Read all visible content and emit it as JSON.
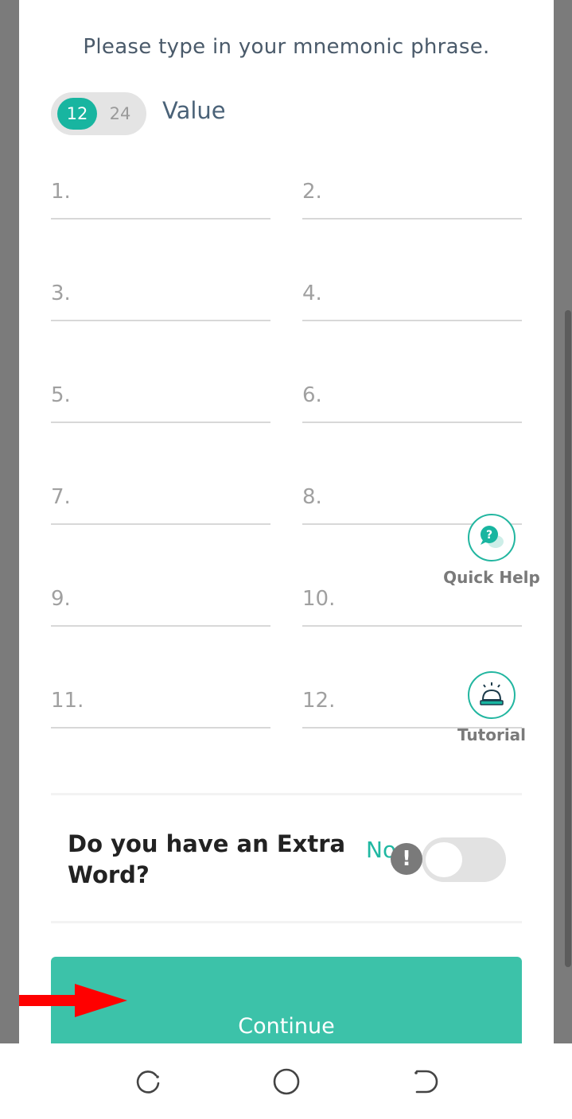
{
  "header": {
    "prompt": "Please type in your mnemonic phrase."
  },
  "length_selector": {
    "options": [
      "12",
      "24"
    ],
    "selected": "12",
    "label": "Value"
  },
  "words": [
    {
      "label": "1."
    },
    {
      "label": "2."
    },
    {
      "label": "3."
    },
    {
      "label": "4."
    },
    {
      "label": "5."
    },
    {
      "label": "6."
    },
    {
      "label": "7."
    },
    {
      "label": "8."
    },
    {
      "label": "9."
    },
    {
      "label": "10."
    },
    {
      "label": "11."
    },
    {
      "label": "12."
    }
  ],
  "floating": {
    "quick_help": "Quick Help",
    "tutorial": "Tutorial"
  },
  "extra_word": {
    "question": "Do you have an Extra Word?",
    "toggle_label": "No",
    "toggle_on": false,
    "warning_glyph": "!"
  },
  "actions": {
    "continue": "Continue"
  },
  "colors": {
    "accent": "#18b5a0",
    "button": "#3cc2a9",
    "arrow": "#ff0000"
  },
  "icons": {
    "quick_help": "chat-question-icon",
    "tutorial": "service-bell-icon",
    "nav_recents": "recents-icon",
    "nav_home": "home-icon",
    "nav_back": "back-icon",
    "annotation": "red-arrow-icon"
  }
}
